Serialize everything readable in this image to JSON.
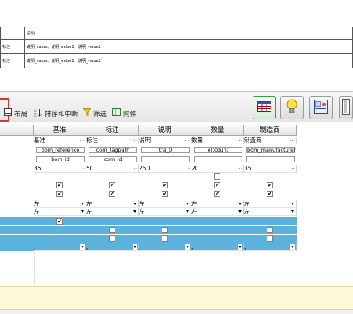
{
  "doc": {
    "header_text": "说明",
    "rows": [
      {
        "label": "标注",
        "value": "说明_value、说明_value1、说明_value2"
      },
      {
        "label": "标注",
        "value": "说明_value、说明_value1、说明_value2"
      }
    ]
  },
  "toolbar": {
    "layout_label": "布局",
    "sort_label": "排序和中断",
    "filter_label": "筛选",
    "attach_label": "附件"
  },
  "grid": {
    "columns": [
      "基准",
      "标注",
      "说明",
      "数量",
      "制造商"
    ],
    "name_row": [
      "基准",
      "标注",
      "说明",
      "数量",
      "制造商"
    ],
    "param_row": [
      "bom_reference",
      "com_tagpath",
      "tra_0",
      "eltcount",
      "bom_manufacturer"
    ],
    "param_row2": [
      "bom_id",
      "com_id",
      "",
      "",
      ""
    ],
    "width_row": [
      "35",
      "50",
      "250",
      "20",
      "35"
    ],
    "checkbox_row1": [
      false,
      false,
      false,
      false,
      false
    ],
    "checkbox_row2": [
      true,
      true,
      true,
      true,
      true
    ],
    "checkbox_row3": [
      true,
      true,
      true,
      true,
      true
    ],
    "align_row1": [
      "左",
      "左",
      "左",
      "左",
      "左"
    ],
    "align_row2": [
      "左",
      "左",
      "左",
      "左",
      "左"
    ],
    "blue_row1_checks": [
      true,
      false,
      false,
      false,
      false
    ],
    "blue_row2_checks": [
      false,
      false,
      false,
      false,
      false
    ],
    "blue_row3_commas": [
      ",",
      ",",
      ",",
      ",",
      ","
    ]
  },
  "colors": {
    "selection_blue": "#5bb3dd",
    "status_bar": "#fdf8d8",
    "highlight_red": "#e03030"
  }
}
